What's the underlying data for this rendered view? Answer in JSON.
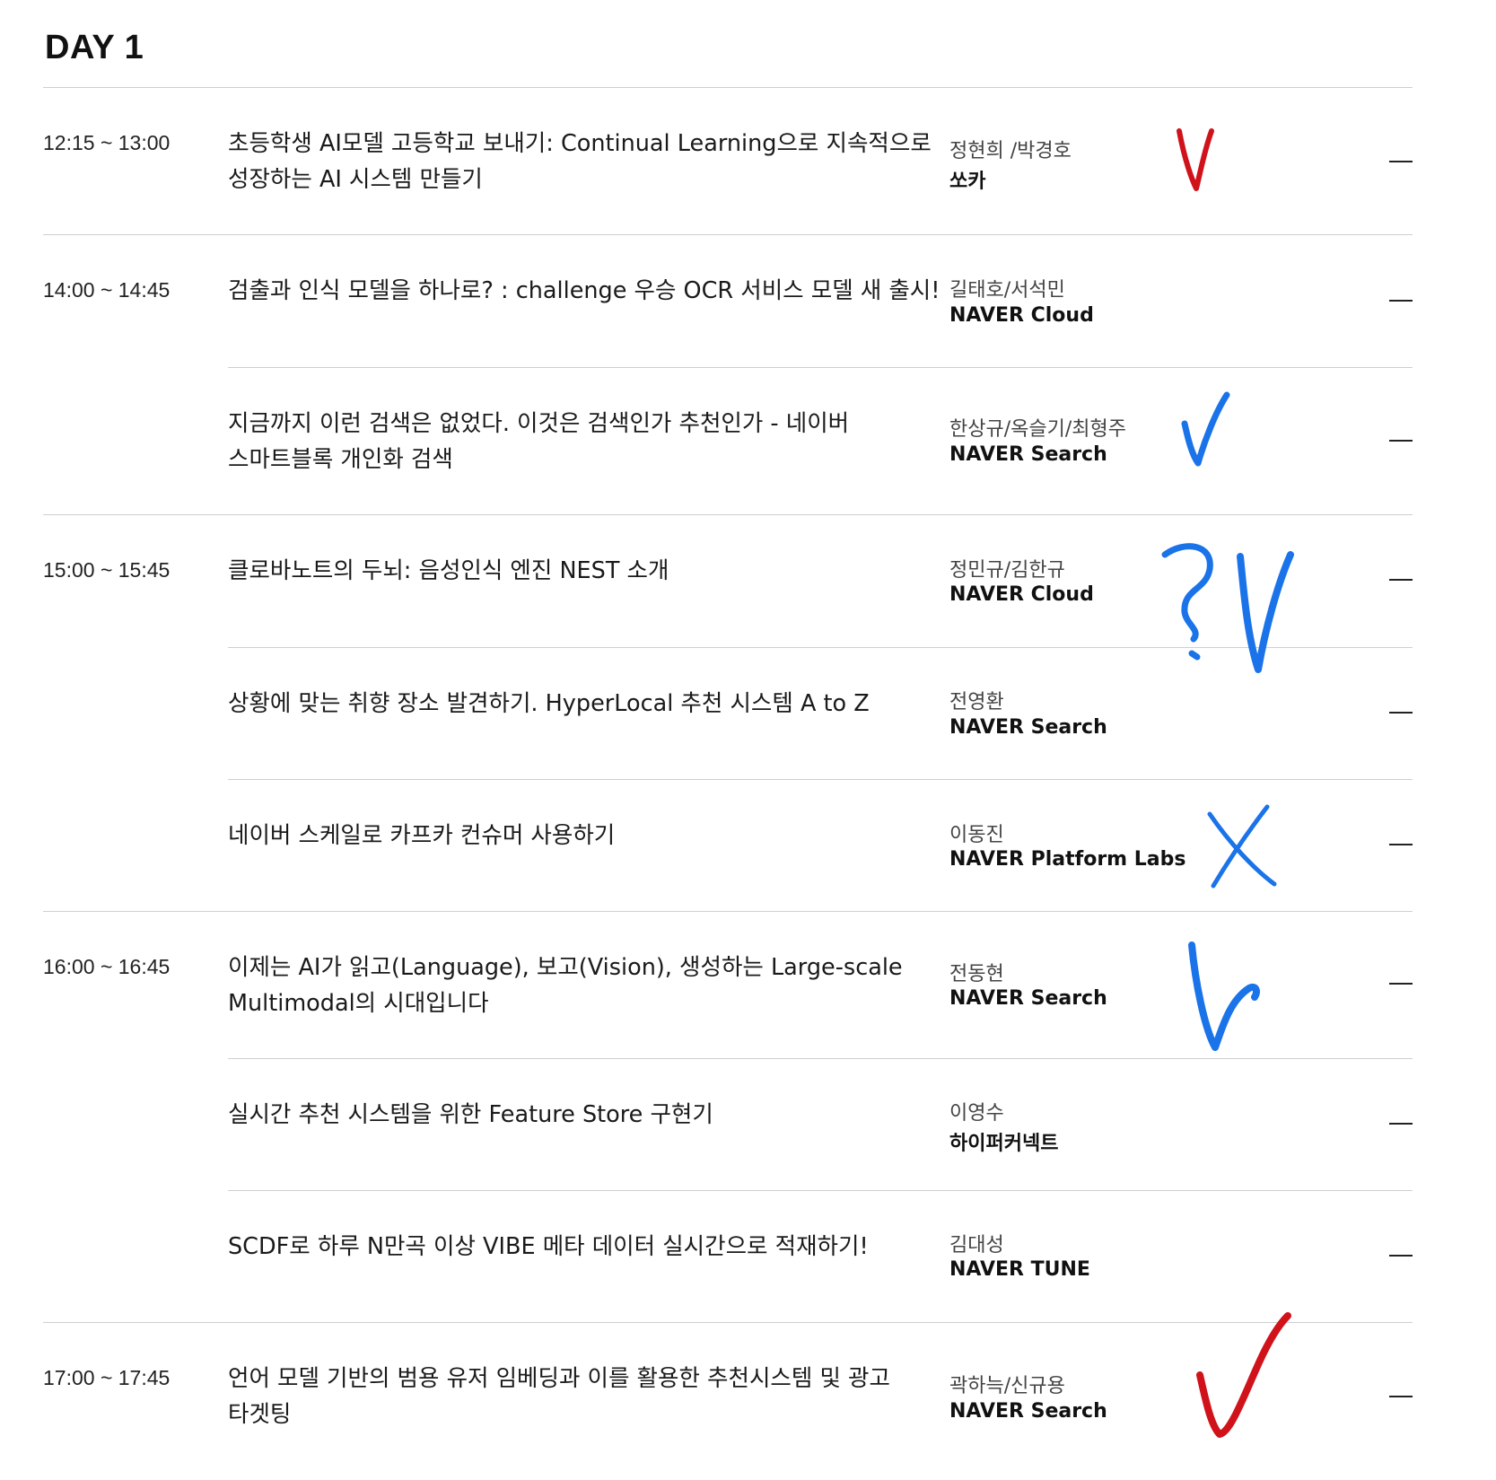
{
  "day_title": "DAY 1",
  "sessions": [
    {
      "time": "12:15 ~ 13:00",
      "title_line1": "초등학생 AI모델 고등학교 보내기: Continual Learning으로 지속적으로",
      "title_line2": "성장하는 AI 시스템 만들기",
      "speakers": "정현희 /박경호",
      "org": "쏘카"
    },
    {
      "time": "14:00 ~ 14:45",
      "title_line1": "검출과 인식 모델을 하나로? : challenge 우승 OCR 서비스 모델 새 출시!",
      "speakers": "길태호/서석민",
      "org": "NAVER Cloud"
    },
    {
      "title_line1": "지금까지 이런 검색은 없었다. 이것은 검색인가 추천인가 - 네이버",
      "title_line2": "스마트블록 개인화 검색",
      "speakers": "한상규/옥슬기/최형주",
      "org": "NAVER Search"
    },
    {
      "time": "15:00 ~ 15:45",
      "title_line1": "클로바노트의 두뇌: 음성인식 엔진 NEST 소개",
      "speakers": "정민규/김한규",
      "org": "NAVER Cloud"
    },
    {
      "title_line1": "상황에 맞는 취향 장소 발견하기. HyperLocal 추천 시스템 A to Z",
      "speakers": "전영환",
      "org": "NAVER Search"
    },
    {
      "title_line1": "네이버 스케일로 카프카 컨슈머 사용하기",
      "speakers": "이동진",
      "org": "NAVER Platform Labs"
    },
    {
      "time": "16:00 ~ 16:45",
      "title_line1": "이제는 AI가 읽고(Language), 보고(Vision), 생성하는 Large-scale",
      "title_line2": "Multimodal의 시대입니다",
      "speakers": "전동현",
      "org": "NAVER Search"
    },
    {
      "title_line1": "실시간 추천 시스템을 위한 Feature Store 구현기",
      "speakers": "이영수",
      "org": "하이퍼커넥트"
    },
    {
      "title_line1": "SCDF로 하루 N만곡 이상 VIBE 메타 데이터 실시간으로 적재하기!",
      "speakers": "김대성",
      "org": "NAVER TUNE"
    },
    {
      "time": "17:00 ~ 17:45",
      "title_line1": "언어 모델 기반의 범용 유저 임베딩과 이를 활용한 추천시스템 및 광고",
      "title_line2": "타겟팅",
      "speakers": "곽하늑/신규용",
      "org": "NAVER Search"
    }
  ],
  "annotations": {
    "colors": {
      "red": "#d0121b",
      "blue": "#1a73e8"
    },
    "marks": [
      "red-check",
      "blue-check",
      "blue-question-check",
      "blue-x",
      "blue-check",
      "red-check"
    ]
  }
}
